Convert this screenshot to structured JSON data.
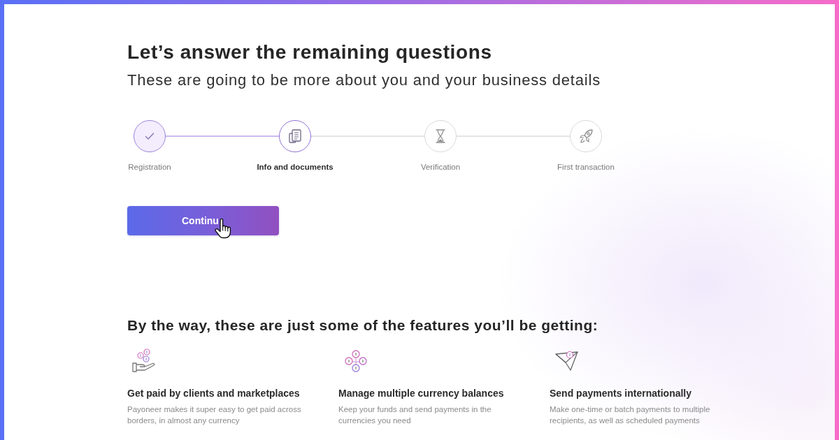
{
  "header": {
    "title": "Let’s answer the remaining questions",
    "subtitle": "These are going to be more about you and your business details"
  },
  "steps": [
    {
      "label": "Registration",
      "completed": true,
      "selected": false
    },
    {
      "label": "Info and documents",
      "completed": false,
      "selected": true
    },
    {
      "label": "Verification",
      "completed": false,
      "selected": false
    },
    {
      "label": "First transaction",
      "completed": false,
      "selected": false
    }
  ],
  "continue_button": {
    "label": "Continu"
  },
  "features": {
    "heading": "By the way, these are just some of the features you’ll be getting:",
    "items": [
      {
        "title": "Get paid by clients and marketplaces",
        "description": "Payoneer makes it super easy to get paid across borders, in almost any currency"
      },
      {
        "title": "Manage multiple currency balances",
        "description": "Keep your funds and send payments in the currencies you need"
      },
      {
        "title": "Send payments internationally",
        "description": "Make one-time or batch payments to multiple recipients, as well as scheduled payments"
      }
    ]
  }
}
